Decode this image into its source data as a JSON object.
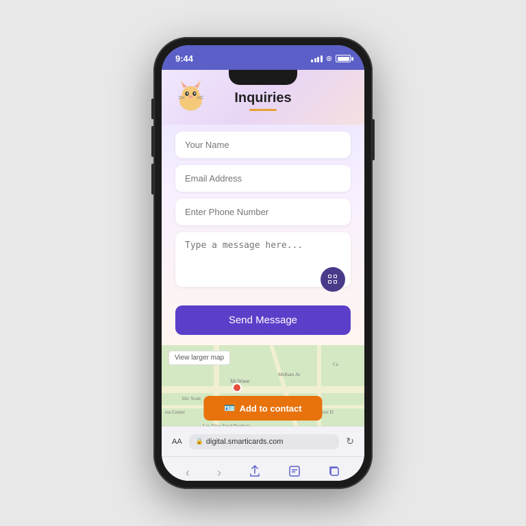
{
  "statusBar": {
    "time": "9:44",
    "accentColor": "#5b5fc7"
  },
  "header": {
    "title": "Inquiries",
    "underlineColor": "#e8a030"
  },
  "form": {
    "namePlaceholder": "Your Name",
    "emailPlaceholder": "Email Address",
    "phonePlaceholder": "Enter Phone Number",
    "messagePlaceholder": "Type a message here...",
    "sendButtonLabel": "Send Message",
    "sendButtonColor": "#5b3fc8"
  },
  "map": {
    "viewLargerMapLabel": "View larger map",
    "addToContactLabel": "Add to contact",
    "addToContactColor": "#e8720c",
    "labels": {
      "mcwane": "McWane",
      "publicScale": "blic Scale",
      "melhamAv": "Melham Av",
      "essCenter": "ess Center",
      "losAltos": "Los Altos Food Products",
      "ramirezD": "Ramirez D"
    }
  },
  "browserBar": {
    "fontSizeLabel": "AA",
    "url": "digital.smarticards.com",
    "lockIcon": "🔒"
  },
  "bottomNav": {
    "backLabel": "‹",
    "forwardLabel": "›",
    "shareLabel": "↑",
    "bookmarkLabel": "□",
    "tabsLabel": "⊞"
  }
}
